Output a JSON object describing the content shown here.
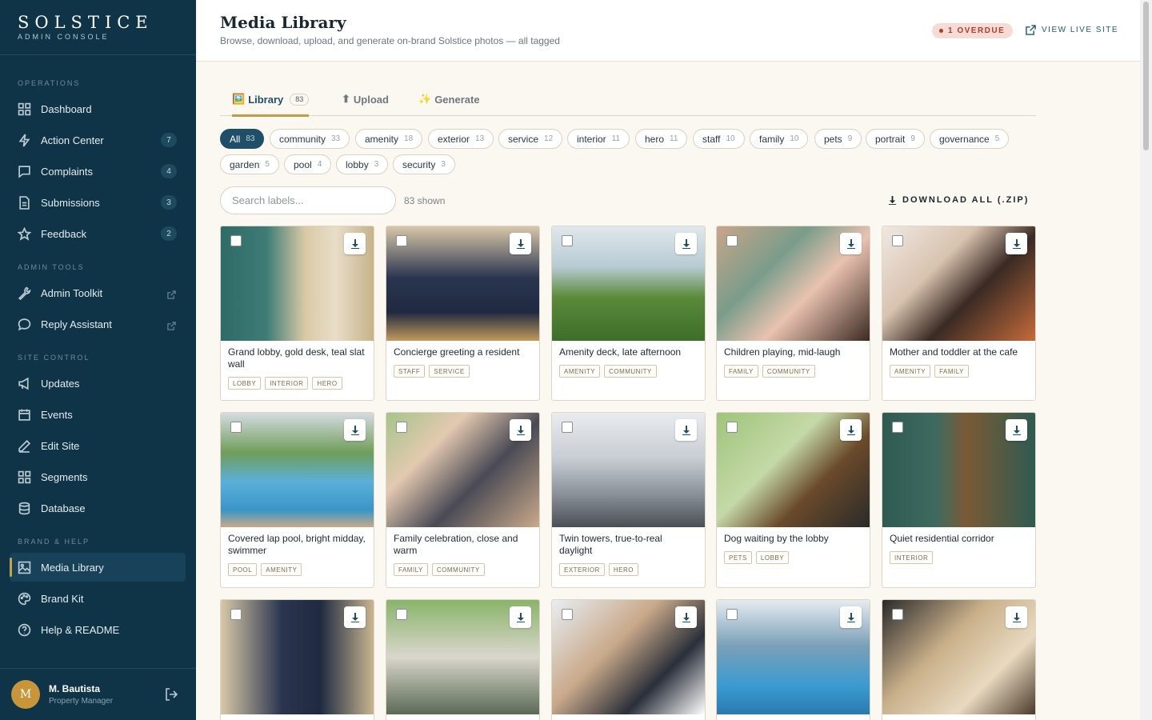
{
  "brand": {
    "name": "SOLSTICE",
    "subtitle": "ADMIN CONSOLE"
  },
  "sidebar": {
    "sections": [
      {
        "label": "OPERATIONS"
      },
      {
        "label": "ADMIN TOOLS"
      },
      {
        "label": "SITE CONTROL"
      },
      {
        "label": "BRAND & HELP"
      }
    ],
    "items": [
      {
        "label": "Dashboard",
        "icon": "grid-icon"
      },
      {
        "label": "Action Center",
        "icon": "bolt-icon",
        "badge": "7"
      },
      {
        "label": "Complaints",
        "icon": "chat-icon",
        "badge": "4"
      },
      {
        "label": "Submissions",
        "icon": "document-icon",
        "badge": "3"
      },
      {
        "label": "Feedback",
        "icon": "star-icon",
        "badge": "2"
      },
      {
        "label": "Admin Toolkit",
        "icon": "wrench-icon",
        "external": true
      },
      {
        "label": "Reply Assistant",
        "icon": "chat-bubble-icon",
        "external": true
      },
      {
        "label": "Updates",
        "icon": "megaphone-icon"
      },
      {
        "label": "Events",
        "icon": "calendar-icon"
      },
      {
        "label": "Edit Site",
        "icon": "pencil-icon"
      },
      {
        "label": "Segments",
        "icon": "grid-icon"
      },
      {
        "label": "Database",
        "icon": "database-icon"
      },
      {
        "label": "Media Library",
        "icon": "image-icon",
        "active": true
      },
      {
        "label": "Brand Kit",
        "icon": "palette-icon"
      },
      {
        "label": "Help & README",
        "icon": "help-icon"
      }
    ],
    "user": {
      "initial": "M",
      "name": "M. Bautista",
      "role": "Property Manager"
    }
  },
  "header": {
    "title": "Media Library",
    "subtitle": "Browse, download, upload, and generate on-brand Solstice photos — all tagged",
    "overdue": "1 OVERDUE",
    "live_site": "VIEW LIVE SITE"
  },
  "tabs": [
    {
      "icon": "🖼️",
      "label": "Library",
      "count": "83",
      "active": true
    },
    {
      "icon": "⬆",
      "label": "Upload"
    },
    {
      "icon": "✨",
      "label": "Generate"
    }
  ],
  "filters": [
    {
      "label": "All",
      "count": "83",
      "active": true
    },
    {
      "label": "community",
      "count": "33"
    },
    {
      "label": "amenity",
      "count": "18"
    },
    {
      "label": "exterior",
      "count": "13"
    },
    {
      "label": "service",
      "count": "12"
    },
    {
      "label": "interior",
      "count": "11"
    },
    {
      "label": "hero",
      "count": "11"
    },
    {
      "label": "staff",
      "count": "10"
    },
    {
      "label": "family",
      "count": "10"
    },
    {
      "label": "pets",
      "count": "9"
    },
    {
      "label": "portrait",
      "count": "9"
    },
    {
      "label": "governance",
      "count": "5"
    },
    {
      "label": "garden",
      "count": "5"
    },
    {
      "label": "pool",
      "count": "4"
    },
    {
      "label": "lobby",
      "count": "3"
    },
    {
      "label": "security",
      "count": "3"
    }
  ],
  "search": {
    "placeholder": "Search labels...",
    "shown": "83 shown",
    "download_all": "DOWNLOAD ALL (.ZIP)"
  },
  "cards": [
    {
      "caption": "Grand lobby, gold desk, teal slat wall",
      "tags": [
        "LOBBY",
        "INTERIOR",
        "HERO"
      ],
      "scene": "lobby"
    },
    {
      "caption": "Concierge greeting a resident",
      "tags": [
        "STAFF",
        "SERVICE"
      ],
      "scene": "concierge"
    },
    {
      "caption": "Amenity deck, late afternoon",
      "tags": [
        "AMENITY",
        "COMMUNITY"
      ],
      "scene": "deck"
    },
    {
      "caption": "Children playing, mid-laugh",
      "tags": [
        "FAMILY",
        "COMMUNITY"
      ],
      "scene": "children"
    },
    {
      "caption": "Mother and toddler at the cafe",
      "tags": [
        "AMENITY",
        "FAMILY"
      ],
      "scene": "cafe"
    },
    {
      "caption": "Covered lap pool, bright midday, swimmer",
      "tags": [
        "POOL",
        "AMENITY"
      ],
      "scene": "pool"
    },
    {
      "caption": "Family celebration, close and warm",
      "tags": [
        "FAMILY",
        "COMMUNITY"
      ],
      "scene": "celebration"
    },
    {
      "caption": "Twin towers, true-to-real daylight",
      "tags": [
        "EXTERIOR",
        "HERO"
      ],
      "scene": "towers"
    },
    {
      "caption": "Dog waiting by the lobby",
      "tags": [
        "PETS",
        "LOBBY"
      ],
      "scene": "dog"
    },
    {
      "caption": "Quiet residential corridor",
      "tags": [
        "INTERIOR"
      ],
      "scene": "corridor"
    },
    {
      "caption": "",
      "tags": [],
      "scene": "guard"
    },
    {
      "caption": "",
      "tags": [],
      "scene": "doorman"
    },
    {
      "caption": "",
      "tags": [],
      "scene": "signing"
    },
    {
      "caption": "",
      "tags": [],
      "scene": "poolside"
    },
    {
      "caption": "",
      "tags": [],
      "scene": "resident"
    }
  ],
  "colors": {
    "sidebar": "#0f3447",
    "accent": "#c89a42",
    "primary": "#1f4e68",
    "alert": "#b3392c"
  }
}
